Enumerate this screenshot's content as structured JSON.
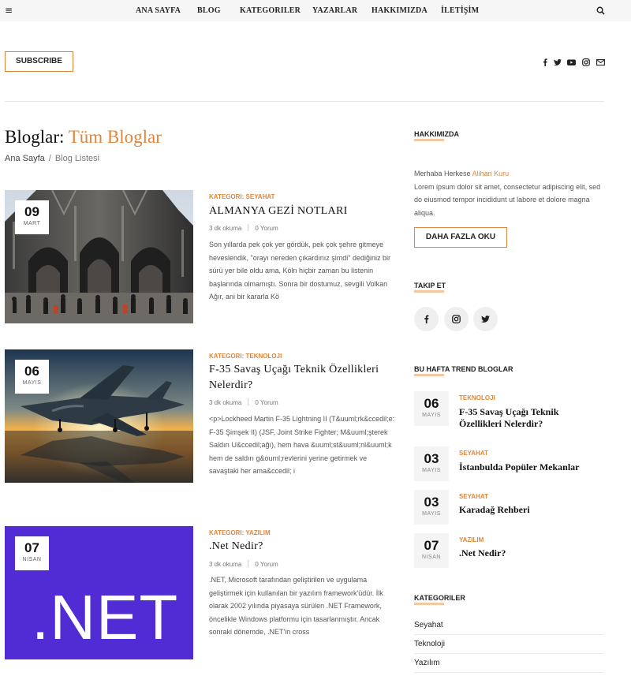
{
  "nav": {
    "items": [
      "ANA SAYFA",
      "BLOG",
      "KATEGORILER",
      "YAZARLAR",
      "HAKKIMIZDA",
      "İLETİŞİM"
    ],
    "menu_icon": "hamburger-icon",
    "search_icon": "search-icon"
  },
  "header": {
    "subscribe_label": "SUBSCRIBE",
    "social_icons": [
      "facebook-icon",
      "twitter-icon",
      "youtube-icon",
      "instagram-icon",
      "mail-icon"
    ]
  },
  "page": {
    "title_prefix": "Bloglar:",
    "title_accent": "Tüm Bloglar",
    "breadcrumb": {
      "home": "Ana Sayfa",
      "separator": "/",
      "current": "Blog Listesi"
    }
  },
  "posts": [
    {
      "day": "09",
      "month": "MART",
      "category": "KATEGORI: SEYAHAT",
      "title": "ALMANYA GEZİ NOTLARI",
      "read_time": "3 dk okuma",
      "comments": "0 Yorum",
      "excerpt": "Son yıllarda pek çok yer gördük, pek çok şehre gitmeye heveslendik, \"orayı nereden çıkardınız şimdi\" dediğiniz bir sürü yer bile oldu ama, Köln hiçbir zaman bu listenin başlarında olmamıştı. Sonra bir dostumuz, sevgili Volkan Ağır, ani bir kararla Kö"
    },
    {
      "day": "06",
      "month": "MAYIS",
      "category": "KATEGORI: TEKNOLOJI",
      "title": "F-35 Savaş Uçağı Teknik Özellikleri Nelerdir?",
      "read_time": "3 dk okuma",
      "comments": "0 Yorum",
      "excerpt": "<p>Lockheed Martin F-35 Lightning II (T&uuml;rk&ccedil;e: F-35 Şimşek II) (JSF, Joint Strike Fighter; M&uuml;şterek Saldırı U&ccedil;ağı), hem hava &uuml;st&uuml;nl&uuml;k hem de saldırı g&ouml;revlerini yerine getirmek ve savaştaki her ama&ccedil; i"
    },
    {
      "day": "07",
      "month": "NISAN",
      "category": "KATEGORI: YAZILIM",
      "title": ".Net Nedir?",
      "read_time": "3 dk okuma",
      "comments": "0 Yorum",
      "excerpt": ".NET, Microsoft tarafından geliştirilen ve uygulama geliştirmek için kullanılan bir yazılım framework'üdür. İlk olarak 2002 yılında piyasaya sürülen .NET Framework, öncelikle Windows platformu için tasarlanmıştır. Ancak sonraki dönemde, .NET'in cross",
      "image_text": ".NET"
    }
  ],
  "sidebar": {
    "about": {
      "heading": "HAKKIMIZDA",
      "greeting": "Merhaba Herkese",
      "author": "Alihan Kuru",
      "text": "Lorem ipsum dolor sit amet, consectetur adipiscing elit, sed do eiusmod tempor incididunt ut labore et dolore magna aliqua.",
      "button": "DAHA FAZLA OKU"
    },
    "follow": {
      "heading": "TAKIP ET",
      "icons": [
        "facebook-icon",
        "instagram-icon",
        "twitter-icon"
      ]
    },
    "trending": {
      "heading": "BU HAFTA TREND BLOGLAR",
      "items": [
        {
          "day": "06",
          "month": "MAYIS",
          "category": "TEKNOLOJI",
          "title": "F-35 Savaş Uçağı Teknik Özellikleri Nelerdir?"
        },
        {
          "day": "03",
          "month": "MAYIS",
          "category": "SEYAHAT",
          "title": "İstanbulda Popüler Mekanlar"
        },
        {
          "day": "03",
          "month": "MAYIS",
          "category": "SEYAHAT",
          "title": "Karadağ Rehberi"
        },
        {
          "day": "07",
          "month": "NISAN",
          "category": "YAZILIM",
          "title": ".Net Nedir?"
        }
      ]
    },
    "categories": {
      "heading": "KATEGORILER",
      "items": [
        "Seyahat",
        "Teknoloji",
        "Yazılım"
      ]
    }
  },
  "colors": {
    "accent": "#e0863a",
    "dotnet_purple": "#512bd4"
  }
}
